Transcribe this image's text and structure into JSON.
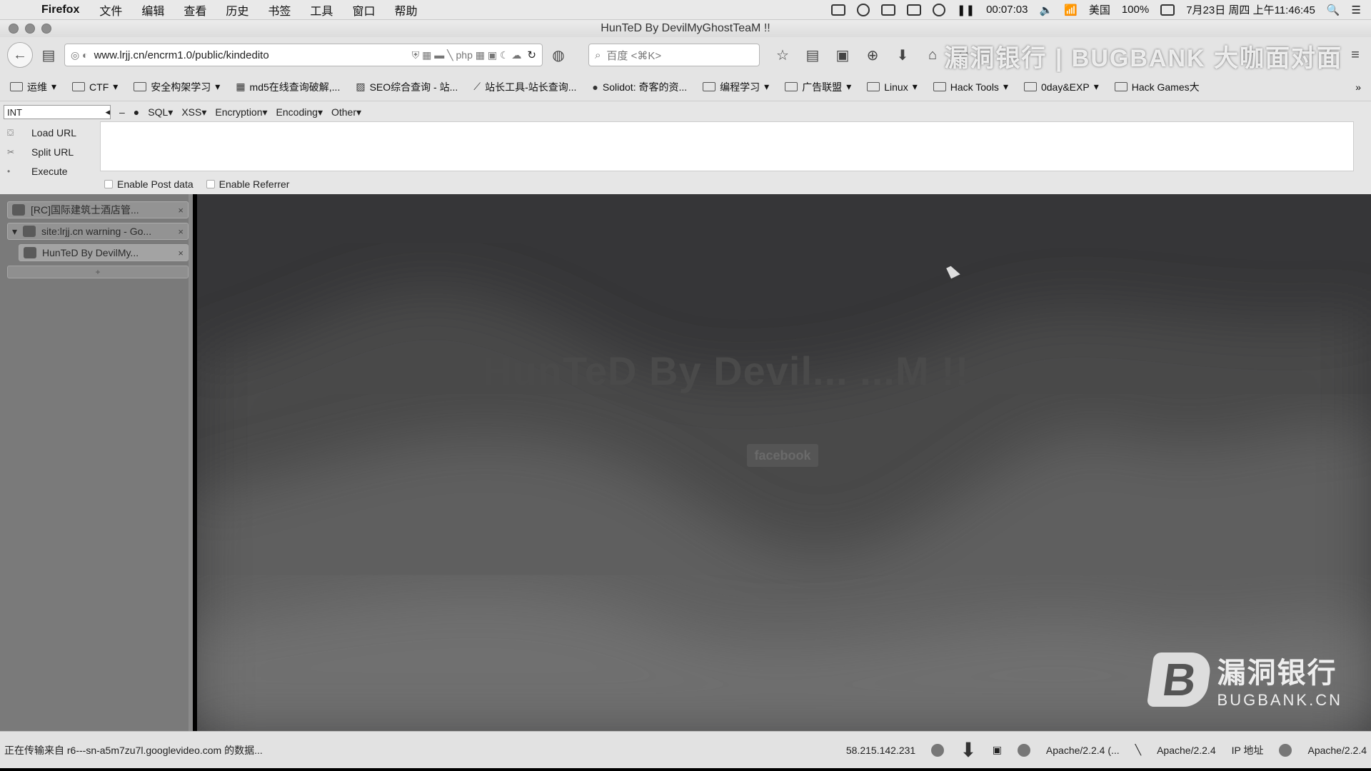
{
  "menubar": {
    "app": "Firefox",
    "items": [
      "文件",
      "编辑",
      "查看",
      "历史",
      "书签",
      "工具",
      "窗口",
      "帮助"
    ],
    "timer": "00:07:03",
    "battery": "100%",
    "input_method": "美国",
    "datetime": "7月23日 周四 上午11:46:45"
  },
  "window": {
    "title": "HunTeD By DevilMyGhostTeaM !!"
  },
  "navbar": {
    "url": "www.lrjj.cn/encrm1.0/public/kindedito",
    "search_placeholder": "百度 <⌘K>",
    "watermark": "漏洞银行 | BUGBANK 大咖面对面"
  },
  "bookmarks": [
    {
      "label": "运维",
      "icon": "folder-icon",
      "dropdown": true
    },
    {
      "label": "CTF",
      "icon": "folder-icon",
      "dropdown": true
    },
    {
      "label": "安全构架学习",
      "icon": "folder-icon",
      "dropdown": true
    },
    {
      "label": "md5在线查询破解,...",
      "icon": "grid-icon",
      "dropdown": false
    },
    {
      "label": "SEO综合查询 - 站...",
      "icon": "page-icon",
      "dropdown": false
    },
    {
      "label": "站长工具-站长查询...",
      "icon": "page-icon",
      "dropdown": false
    },
    {
      "label": "Solidot: 奇客的资...",
      "icon": "globe-icon",
      "dropdown": false
    },
    {
      "label": "编程学习",
      "icon": "folder-icon",
      "dropdown": true
    },
    {
      "label": "广告联盟",
      "icon": "folder-icon",
      "dropdown": true
    },
    {
      "label": "Linux",
      "icon": "folder-icon",
      "dropdown": true
    },
    {
      "label": "Hack Tools",
      "icon": "folder-icon",
      "dropdown": true
    },
    {
      "label": "0day&EXP",
      "icon": "folder-icon",
      "dropdown": true
    },
    {
      "label": "Hack Games大",
      "icon": "folder-icon",
      "dropdown": false
    }
  ],
  "hackbar": {
    "select": "INT",
    "menus": [
      "SQL",
      "XSS",
      "Encryption",
      "Encoding",
      "Other"
    ],
    "actions": [
      "Load URL",
      "Split URL",
      "Execute"
    ],
    "checks": [
      "Enable Post data",
      "Enable Referrer"
    ]
  },
  "tabs": [
    {
      "title": "[RC]国际建筑士酒店管...",
      "close": "×"
    },
    {
      "title": "site:lrjj.cn warning - Go...",
      "close": "×"
    },
    {
      "title": "HunTeD By DevilMy...",
      "close": "×"
    }
  ],
  "page": {
    "hacked_title": "HunTeD By Devil...                    ...M !!",
    "facebook_button": "facebook",
    "brand_cn": "漏洞银行",
    "brand_en": "BUGBANK.CN",
    "brand_logo": "B"
  },
  "statusbar": {
    "message": "正在传输来自 r6---sn-a5m7zu7l.googlevideo.com 的数据...",
    "ip": "58.215.142.231",
    "server1": "Apache/2.2.4 (...",
    "server2": "Apache/2.2.4",
    "ip_label": "IP 地址",
    "server3": "Apache/2.2.4"
  }
}
